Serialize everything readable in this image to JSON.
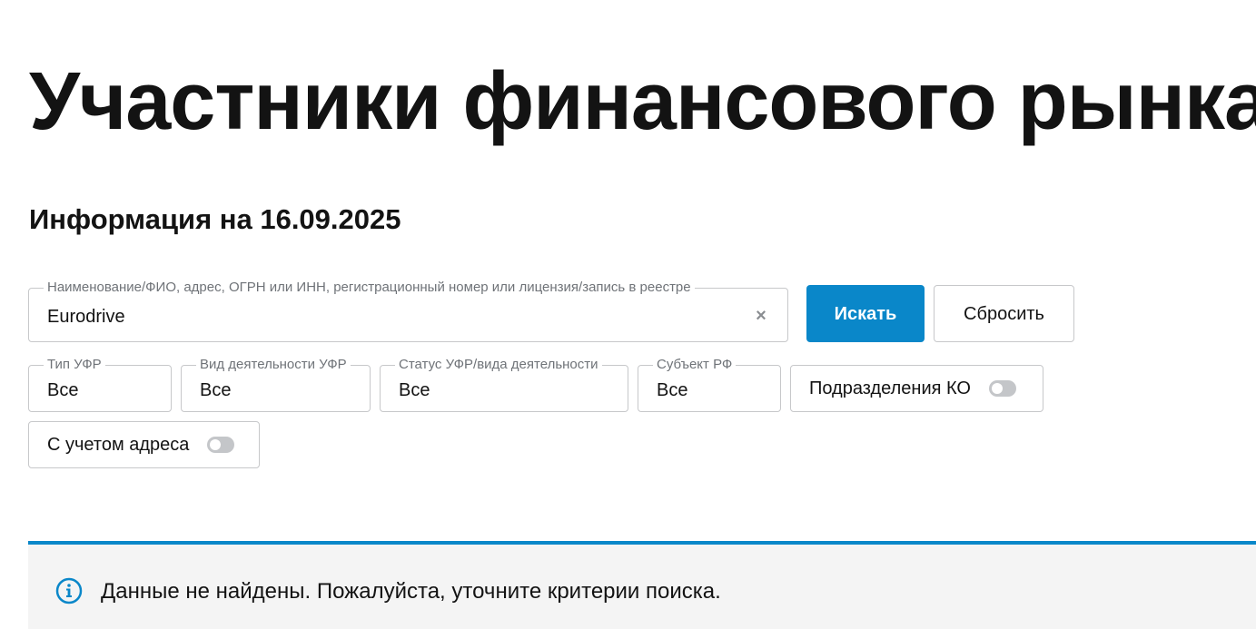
{
  "header": {
    "title": "Участники финансового рынка",
    "info_date": "Информация на 16.09.2025"
  },
  "search": {
    "legend": "Наименование/ФИО, адрес, ОГРН или ИНН, регистрационный номер или лицензия/запись в реестре",
    "value": "Eurodrive",
    "clear_glyph": "×",
    "search_button": "Искать",
    "reset_button": "Сбросить"
  },
  "filters": {
    "type": {
      "legend": "Тип УФР",
      "value": "Все"
    },
    "activity": {
      "legend": "Вид деятельности УФР",
      "value": "Все"
    },
    "status": {
      "legend": "Статус УФР/вида деятельности",
      "value": "Все"
    },
    "region": {
      "legend": "Субъект РФ",
      "value": "Все"
    },
    "divisions_toggle": {
      "label": "Подразделения КО",
      "on": false
    },
    "address_toggle": {
      "label": "С учетом адреса",
      "on": false
    }
  },
  "notice": {
    "text": "Данные не найдены. Пожалуйста, уточните критерии поиска.",
    "icon": "info-icon"
  },
  "colors": {
    "accent": "#0a87c9",
    "text": "#131313",
    "border": "#c7c8ca",
    "notice_bg": "#f4f4f4"
  }
}
